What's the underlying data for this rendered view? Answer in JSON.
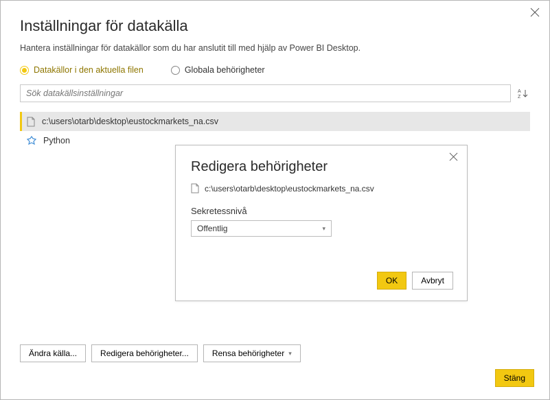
{
  "dialog": {
    "title": "Inställningar för datakälla",
    "subtitle": "Hantera inställningar för datakällor som du har anslutit till med hjälp av Power BI Desktop.",
    "close_icon": "close"
  },
  "radios": {
    "current": "Datakällor i den aktuella filen",
    "global": "Globala behörigheter"
  },
  "search": {
    "placeholder": "Sök datakällsinställningar",
    "sort_icon": "sort-az"
  },
  "sources": [
    {
      "label": "c:\\users\\otarb\\desktop\\eustockmarkets_na.csv",
      "icon": "file",
      "selected": true
    },
    {
      "label": "Python",
      "icon": "python",
      "selected": false
    }
  ],
  "buttons": {
    "change_source": "Ändra källa...",
    "edit_permissions": "Redigera behörigheter...",
    "clear_permissions": "Rensa behörigheter",
    "close": "Stäng"
  },
  "inner": {
    "title": "Redigera behörigheter",
    "path": "c:\\users\\otarb\\desktop\\eustockmarkets_na.csv",
    "privacy_label": "Sekretessnivå",
    "privacy_value": "Offentlig",
    "ok": "OK",
    "cancel": "Avbryt"
  }
}
